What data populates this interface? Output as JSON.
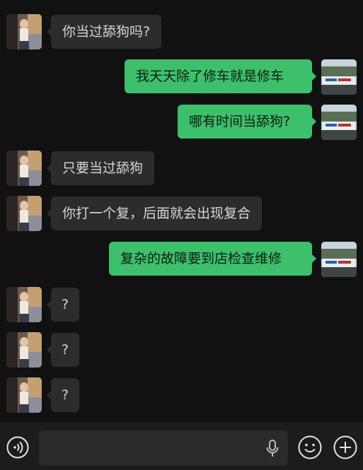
{
  "messages": [
    {
      "side": "left",
      "text": "你当过舔狗吗?"
    },
    {
      "side": "right",
      "text": "我天天除了修车就是修车"
    },
    {
      "side": "right",
      "text": "哪有时间当舔狗?"
    },
    {
      "side": "left",
      "text": "只要当过舔狗"
    },
    {
      "side": "left",
      "text": "你打一个复，后面就会出现复合"
    },
    {
      "side": "right",
      "text": "复杂的故障要到店检查维修"
    },
    {
      "side": "left",
      "text": "?"
    },
    {
      "side": "left",
      "text": "?"
    },
    {
      "side": "left",
      "text": "?"
    }
  ],
  "input": {
    "value": "",
    "placeholder": ""
  },
  "icons": {
    "voice": "voice-icon",
    "mic": "microphone-icon",
    "emoji": "emoji-icon",
    "plus": "plus-icon"
  },
  "colors": {
    "background": "#111111",
    "left_bubble": "#2c2c2c",
    "right_bubble": "#3dbf6b"
  }
}
